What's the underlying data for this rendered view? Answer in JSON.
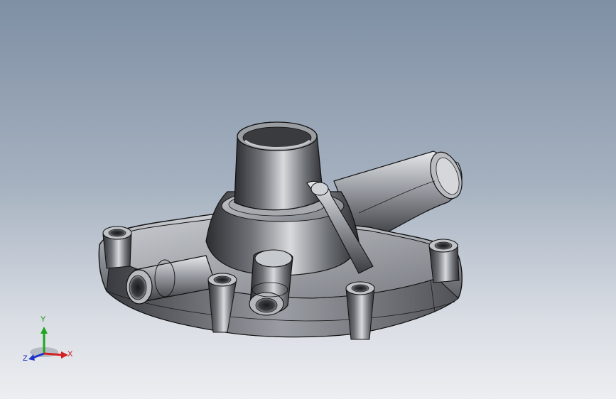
{
  "viewport": {
    "background_top": "#7f8fa4",
    "background_bottom": "#eceef1"
  },
  "model": {
    "part": "water-pump-housing",
    "shade_dark": "#2e2f33",
    "shade_mid": "#6b6e74",
    "shade_light": "#c4c7cc",
    "edge_color": "#111111"
  },
  "triad": {
    "x_label": "X",
    "y_label": "Y",
    "z_label": "Z",
    "x_color": "#d42020",
    "y_color": "#1fa51f",
    "z_color": "#2033c8"
  }
}
